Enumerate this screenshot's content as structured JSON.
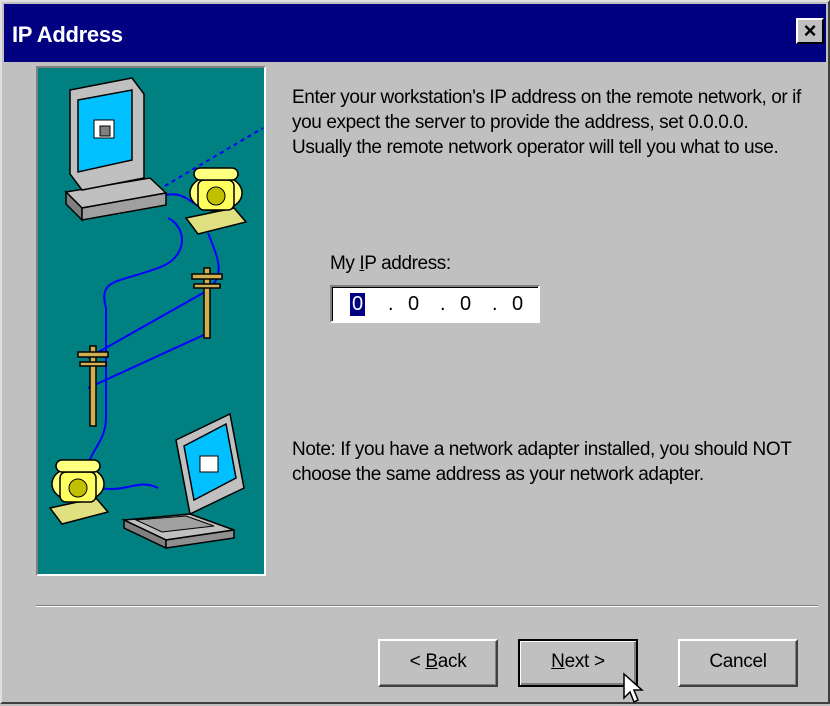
{
  "window": {
    "title": "IP Address",
    "close_label": "×"
  },
  "main": {
    "intro_text": "Enter your workstation's IP address on the remote network, or if you expect the server to provide the address, set 0.0.0.0.  Usually the remote network operator will tell you what to use.",
    "ip_label_prefix": "My ",
    "ip_label_mnemonic": "I",
    "ip_label_suffix": "P address:",
    "ip_octets": [
      "0",
      "0",
      "0",
      "0"
    ],
    "ip_separator": ".",
    "note_text": "Note: If you have a network adapter installed, you should NOT choose the same address as your network adapter."
  },
  "buttons": {
    "back_prefix": "< ",
    "back_mnemonic": "B",
    "back_suffix": "ack",
    "next_mnemonic": "N",
    "next_suffix": "ext >",
    "cancel": "Cancel"
  },
  "colors": {
    "titlebar": "#000080",
    "face": "#c0c0c0",
    "illustration_bg": "#008080",
    "selection": "#000080"
  },
  "icons": [
    "close-icon",
    "computer-icon",
    "telephone-icon",
    "utility-pole-icon",
    "laptop-icon",
    "arrow-cursor-icon"
  ]
}
